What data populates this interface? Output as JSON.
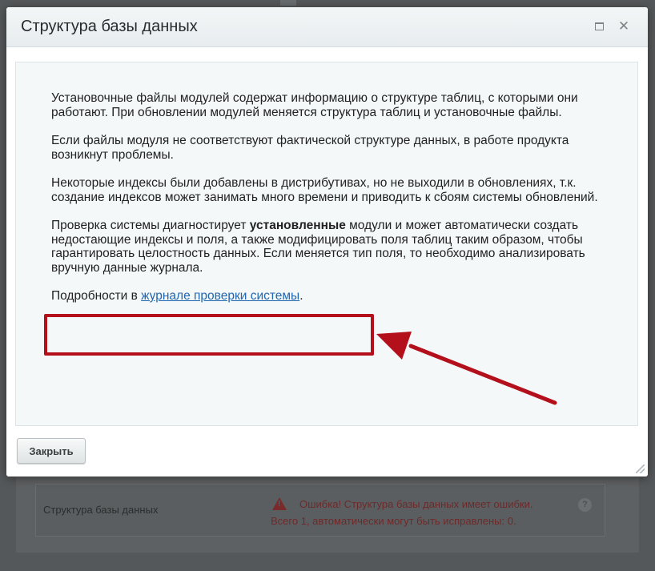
{
  "dialog": {
    "title": "Структура базы данных",
    "paragraphs": {
      "p1": "Установочные файлы модулей содержат информацию о структуре таблиц, с которыми они работают. При обновлении модулей меняется структура таблиц и установочные файлы.",
      "p2": "Если файлы модуля не соответствуют фактической структуре данных, в работе продукта возникнут проблемы.",
      "p3": "Некоторые индексы были добавлены в дистрибутивах, но не выходили в обновлениях, т.к. создание индексов может занимать много времени и приводить к сбоям системы обновлений.",
      "p4_before": "Проверка системы диагностирует ",
      "p4_bold": "установленные",
      "p4_after": " модули и может автоматически создать недостающие индексы и поля, а также модифицировать поля таблиц таким образом, чтобы гарантировать целостность данных. Если меняется тип поля, то необходимо анализировать вручную данные журнала.",
      "p5_before": "Подробности в ",
      "p5_link": "журнале проверки системы",
      "p5_after": "."
    },
    "close_button_label": "Закрыть"
  },
  "background": {
    "row_label": "Структура базы данных",
    "error_line1": "Ошибка! Структура базы данных имеет ошибки.",
    "error_line2": "Всего 1, автоматически могут быть исправлены: 0.",
    "help_glyph": "?"
  },
  "colors": {
    "highlight": "#b3101c",
    "link": "#2067b0",
    "error": "#6e2a2a"
  }
}
